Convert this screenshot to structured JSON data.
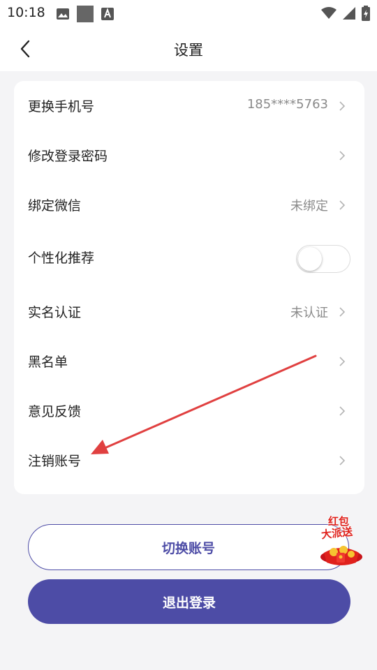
{
  "status_bar": {
    "time": "10:18",
    "left_icons": [
      "image-icon",
      "square-icon",
      "text-a-icon"
    ],
    "right_icons": [
      "wifi-icon",
      "signal-icon",
      "battery-icon"
    ]
  },
  "nav": {
    "title": "设置",
    "back_icon": "chevron-left-icon"
  },
  "settings": {
    "rows": [
      {
        "label": "更换手机号",
        "value": "185****5763",
        "type": "link"
      },
      {
        "label": "修改登录密码",
        "value": "",
        "type": "link"
      },
      {
        "label": "绑定微信",
        "value": "未绑定",
        "type": "link"
      },
      {
        "label": "个性化推荐",
        "value": "",
        "type": "toggle",
        "toggle_on": false
      },
      {
        "label": "实名认证",
        "value": "未认证",
        "type": "link"
      },
      {
        "label": "黑名单",
        "value": "",
        "type": "link"
      },
      {
        "label": "意见反馈",
        "value": "",
        "type": "link"
      },
      {
        "label": "注销账号",
        "value": "",
        "type": "link"
      }
    ]
  },
  "buttons": {
    "switch_account": "切换账号",
    "logout": "退出登录"
  },
  "promo": {
    "line1": "红包",
    "line2": "大派送"
  },
  "colors": {
    "accent": "#4d4ca6",
    "arrow": "#e04040",
    "background": "#f4f4f6"
  }
}
